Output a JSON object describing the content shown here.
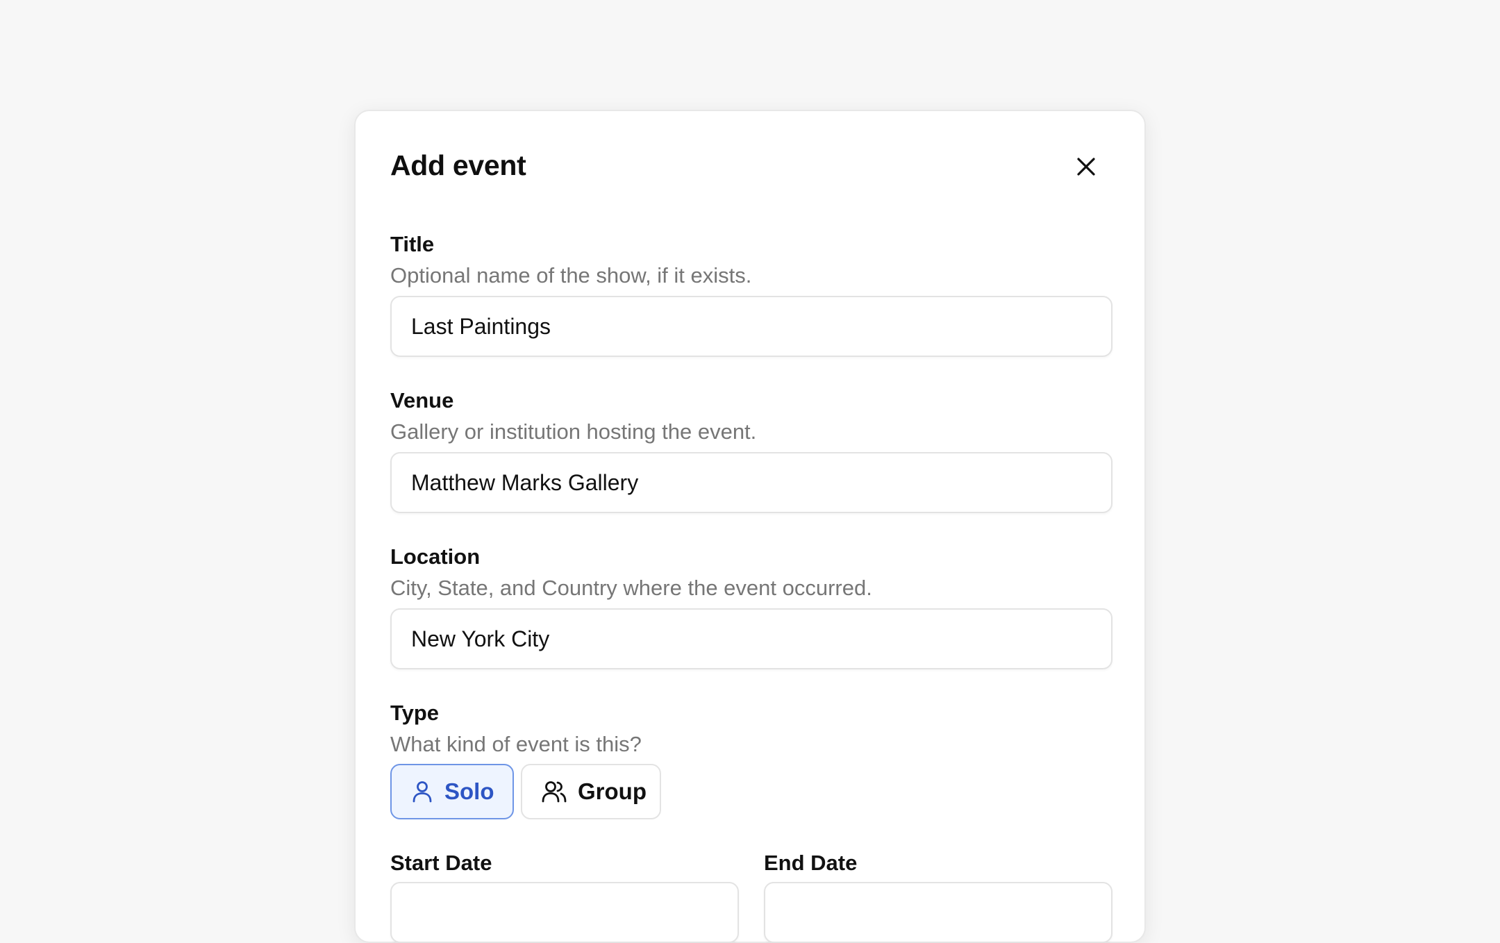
{
  "modal": {
    "title": "Add event"
  },
  "fields": {
    "title": {
      "label": "Title",
      "help": "Optional name of the show, if it exists.",
      "value": "Last Paintings"
    },
    "venue": {
      "label": "Venue",
      "help": "Gallery or institution hosting the event.",
      "value": "Matthew Marks Gallery"
    },
    "location": {
      "label": "Location",
      "help": "City, State, and Country where the event occurred.",
      "value": "New York City"
    },
    "type": {
      "label": "Type",
      "help": "What kind of event is this?",
      "options": [
        {
          "label": "Solo",
          "icon": "user-icon",
          "selected": true
        },
        {
          "label": "Group",
          "icon": "users-icon",
          "selected": false
        }
      ]
    },
    "start_date": {
      "label": "Start Date"
    },
    "end_date": {
      "label": "End Date"
    }
  },
  "colors": {
    "background": "#f7f7f7",
    "selected_accent": "#2d55c4",
    "selected_fill": "#eef4ff",
    "selected_border": "#6e95e6",
    "help_text": "#767676"
  }
}
